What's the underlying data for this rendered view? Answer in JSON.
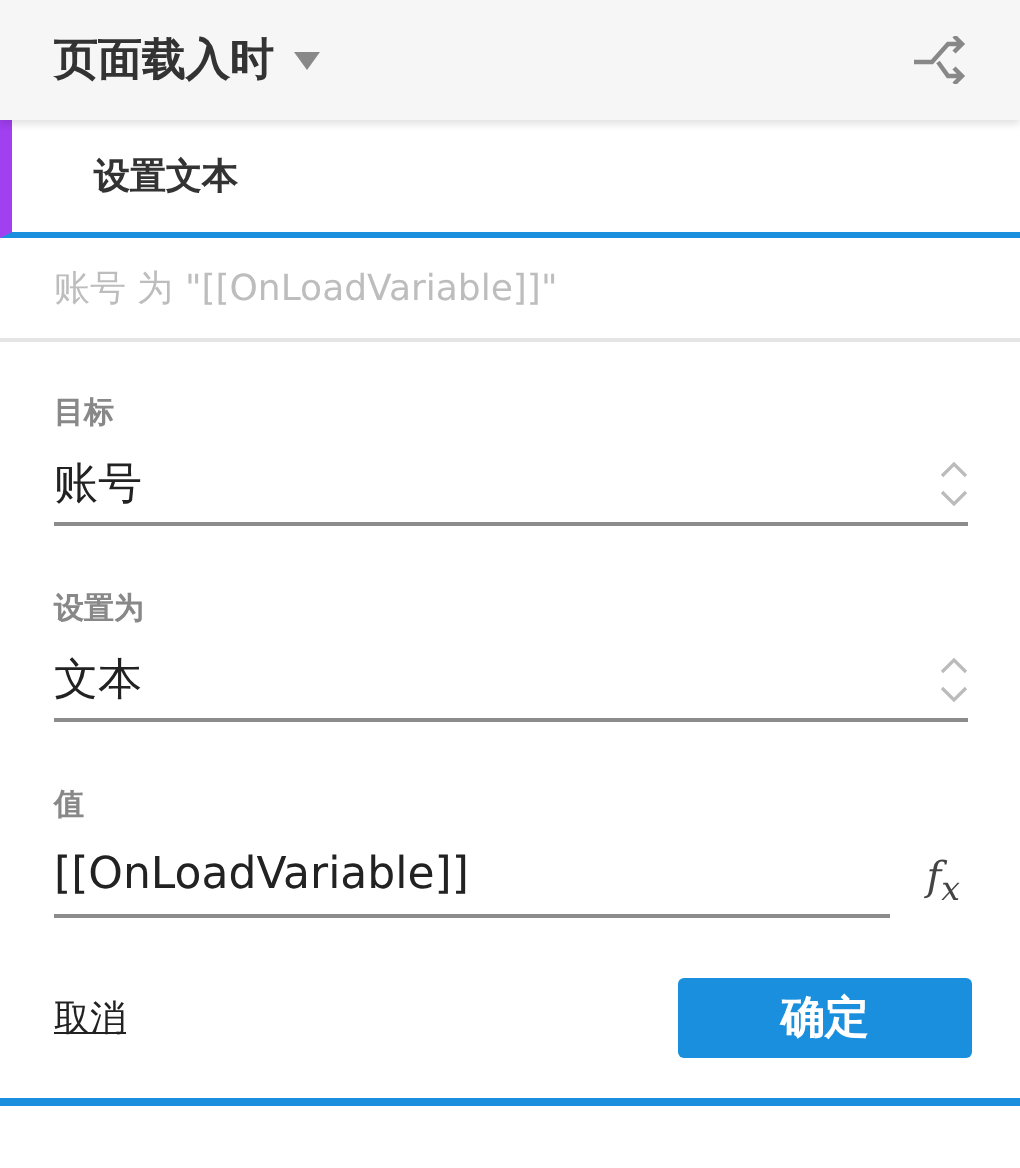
{
  "header": {
    "title": "页面载入时"
  },
  "action": {
    "title": "设置文本",
    "selected": true
  },
  "summary": "账号 为 \"[[OnLoadVariable]]\"",
  "fields": [
    {
      "kind": "select",
      "label": "目标",
      "value": "账号"
    },
    {
      "kind": "select",
      "label": "设置为",
      "value": "文本"
    },
    {
      "kind": "input",
      "label": "值",
      "value": "[[OnLoadVariable]]",
      "button": "f$_{x}$"
    }
  ],
  "cancel": "取消",
  "ok": "确定"
}
